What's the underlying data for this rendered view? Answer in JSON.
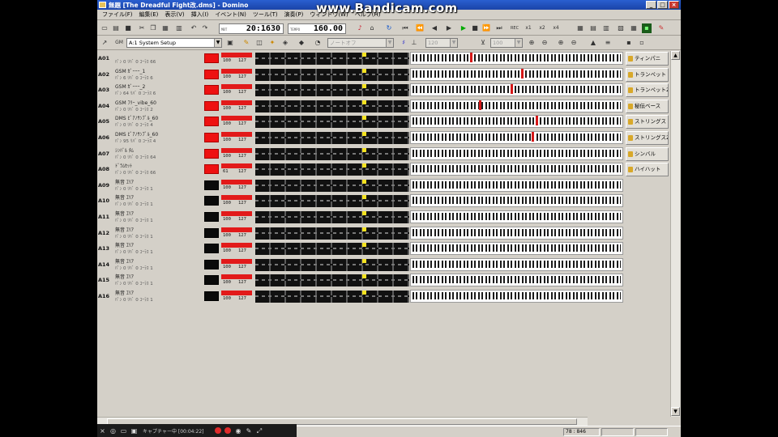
{
  "window": {
    "title": "無題 [The Dreadful Fight改.dms] - Domino",
    "controls": {
      "minimize": "_",
      "maximize": "□",
      "close": "×"
    }
  },
  "watermark": "www.Bandicam.com",
  "menu": [
    "ファイル(F)",
    "編集(E)",
    "表示(V)",
    "挿入(I)",
    "イベント(N)",
    "ツール(T)",
    "演奏(P)",
    "ウィンドウ(W)",
    "ヘルプ(H)"
  ],
  "toolbar": {
    "position_label": "MBT",
    "position_value": "20:1630",
    "tempo_label": "TEMPO",
    "tempo_value": "160.00",
    "snap_values": [
      "x1",
      "x2",
      "x4"
    ],
    "rec_label": "REC"
  },
  "toolbar2": {
    "module_label": "GM",
    "module_value": "A:1 System Setup",
    "note_combo": "ノートオフ",
    "num1": "120",
    "num2": "100"
  },
  "tracks": [
    {
      "id": "A01",
      "name": "",
      "params": "ﾊﾟﾝ  0  ﾘﾊﾞ  0  ｺｰﾗｽ  66",
      "block": "red",
      "v1": "100",
      "v2": "127",
      "marker": 28
    },
    {
      "id": "A02",
      "name": "GSM ｶﾞｰｰｰ_1",
      "params": "ﾊﾟﾝ  6  ﾘﾊﾞ  0  ｺｰﾗｽ  6",
      "block": "red",
      "v1": "100",
      "v2": "127",
      "marker": 52
    },
    {
      "id": "A03",
      "name": "GSM ｶﾞｰｰｰ_2",
      "params": "ﾊﾟﾝ  64  ﾘﾊﾞ  0  ｺｰﾗｽ  6",
      "block": "red",
      "v1": "100",
      "v2": "127",
      "marker": 47
    },
    {
      "id": "A04",
      "name": "GSM ﾌﾘｰ_vibe_60",
      "params": "ﾊﾟﾝ  0  ﾘﾊﾞ  0  ｺｰﾗｽ  2",
      "block": "red",
      "v1": "100",
      "v2": "127",
      "marker": 32
    },
    {
      "id": "A05",
      "name": "DMS ﾋﾟｱﾉｻﾝﾌﾟﾙ_60",
      "params": "ﾊﾟﾝ  0  ﾘﾊﾞ  0  ｺｰﾗｽ  4",
      "block": "red",
      "v1": "100",
      "v2": "127",
      "marker": 59
    },
    {
      "id": "A06",
      "name": "DMS ﾋﾟｱﾉｻﾝﾌﾟﾙ_60",
      "params": "ﾊﾟﾝ  95  ﾘﾊﾞ  0  ｺｰﾗｽ  4",
      "block": "red",
      "v1": "100",
      "v2": "127",
      "marker": 57
    },
    {
      "id": "A07",
      "name": "ｼﾝﾊﾞﾙ ﾀﾑ",
      "params": "ﾊﾟﾝ  0  ﾘﾊﾞ  0  ｺｰﾗｽ  64",
      "block": "red",
      "v1": "100",
      "v2": "127",
      "marker": null
    },
    {
      "id": "A08",
      "name": "ﾄﾞﾗﾑｾｯﾄ",
      "params": "ﾊﾟﾝ  0  ﾘﾊﾞ  0  ｺｰﾗｽ  66",
      "block": "red",
      "v1": "61",
      "v2": "127",
      "marker": null
    },
    {
      "id": "A09",
      "name": "無音 ｴﾘｱ",
      "params": "ﾊﾟﾝ  0  ﾘﾊﾞ  0  ｺｰﾗｽ  1",
      "block": "black",
      "v1": "100",
      "v2": "127",
      "marker": null
    },
    {
      "id": "A10",
      "name": "無音 ｴﾘｱ",
      "params": "ﾊﾟﾝ  0  ﾘﾊﾞ  0  ｺｰﾗｽ  1",
      "block": "black",
      "v1": "100",
      "v2": "127",
      "marker": null
    },
    {
      "id": "A11",
      "name": "無音 ｴﾘｱ",
      "params": "ﾊﾟﾝ  0  ﾘﾊﾞ  0  ｺｰﾗｽ  1",
      "block": "black",
      "v1": "100",
      "v2": "127",
      "marker": null
    },
    {
      "id": "A12",
      "name": "無音 ｴﾘｱ",
      "params": "ﾊﾟﾝ  0  ﾘﾊﾞ  0  ｺｰﾗｽ  1",
      "block": "black",
      "v1": "100",
      "v2": "127",
      "marker": null
    },
    {
      "id": "A13",
      "name": "無音 ｴﾘｱ",
      "params": "ﾊﾟﾝ  0  ﾘﾊﾞ  0  ｺｰﾗｽ  1",
      "block": "black",
      "v1": "100",
      "v2": "127",
      "marker": null
    },
    {
      "id": "A14",
      "name": "無音 ｴﾘｱ",
      "params": "ﾊﾟﾝ  0  ﾘﾊﾞ  0  ｺｰﾗｽ  1",
      "block": "black",
      "v1": "100",
      "v2": "127",
      "marker": null
    },
    {
      "id": "A15",
      "name": "無音 ｴﾘｱ",
      "params": "ﾊﾟﾝ  0  ﾘﾊﾞ  0  ｺｰﾗｽ  1",
      "block": "black",
      "v1": "100",
      "v2": "127",
      "marker": null
    },
    {
      "id": "A16",
      "name": "無音 ｴﾘｱ",
      "params": "ﾊﾟﾝ  0  ﾘﾊﾞ  0  ｺｰﾗｽ  1",
      "block": "black",
      "v1": "100",
      "v2": "127",
      "marker": null
    }
  ],
  "sidebar": [
    "ティンパニ",
    "トランペット",
    "トランペット2",
    "秘伝ベース",
    "ストリングス",
    "ストリングス2",
    "シンバル",
    "ハイハット"
  ],
  "statusbar": {
    "position": "78 : 846"
  },
  "capture": {
    "label": "キャプチャー中 [00:04:22]"
  },
  "colors": {
    "active_block": "#ee1111",
    "silent_block": "#0a0a0a",
    "titlebar": "#2a5fd0",
    "led": "#f5e321"
  }
}
